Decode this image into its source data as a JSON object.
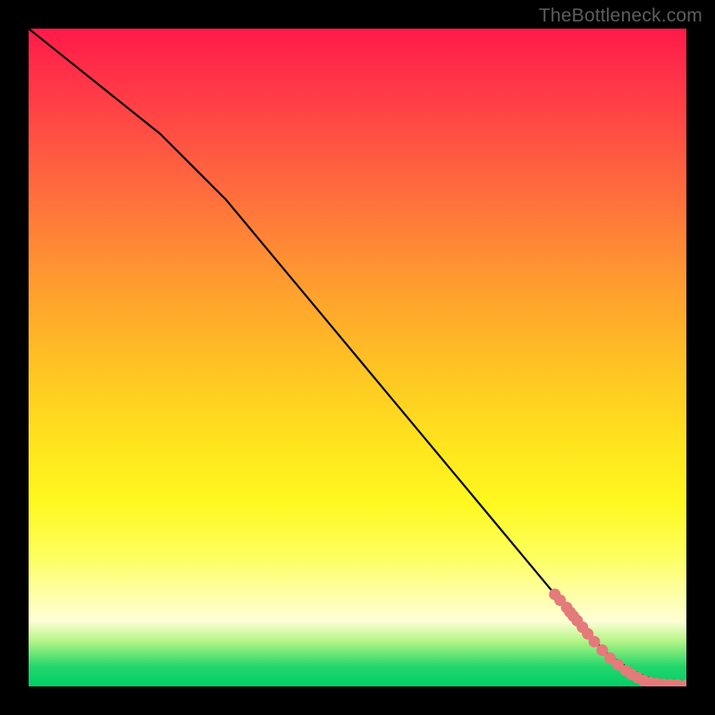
{
  "watermark": "TheBottleneck.com",
  "chart_data": {
    "type": "line",
    "title": "",
    "xlabel": "",
    "ylabel": "",
    "xlim": [
      0,
      100
    ],
    "ylim": [
      0,
      100
    ],
    "grid": false,
    "series": [
      {
        "name": "curve",
        "style": "line",
        "color": "#000000",
        "x": [
          0,
          5,
          10,
          15,
          20,
          25,
          30,
          35,
          40,
          45,
          50,
          55,
          60,
          65,
          70,
          75,
          80,
          83,
          86,
          88,
          90,
          92,
          94,
          96,
          98,
          100
        ],
        "y": [
          100,
          96,
          92,
          88,
          84,
          79,
          74,
          68,
          62,
          56,
          50,
          44,
          38,
          32,
          26,
          20,
          14,
          10,
          7,
          5,
          3.5,
          2.3,
          1.4,
          0.8,
          0.4,
          0.2
        ]
      },
      {
        "name": "marked-points",
        "style": "scatter",
        "color": "#e47a7a",
        "x": [
          80.0,
          80.8,
          81.8,
          82.3,
          82.8,
          83.4,
          84.2,
          85.0,
          86.0,
          87.2,
          88.4,
          89.6,
          90.8,
          91.7,
          92.6,
          93.5,
          94.5,
          95.5,
          96.5,
          97.5,
          98.6,
          100.0
        ],
        "y": [
          14.0,
          13.1,
          12.0,
          11.3,
          10.7,
          10.0,
          9.0,
          8.0,
          6.8,
          5.5,
          4.3,
          3.3,
          2.4,
          1.8,
          1.3,
          0.9,
          0.6,
          0.4,
          0.3,
          0.25,
          0.22,
          0.2
        ]
      }
    ]
  }
}
